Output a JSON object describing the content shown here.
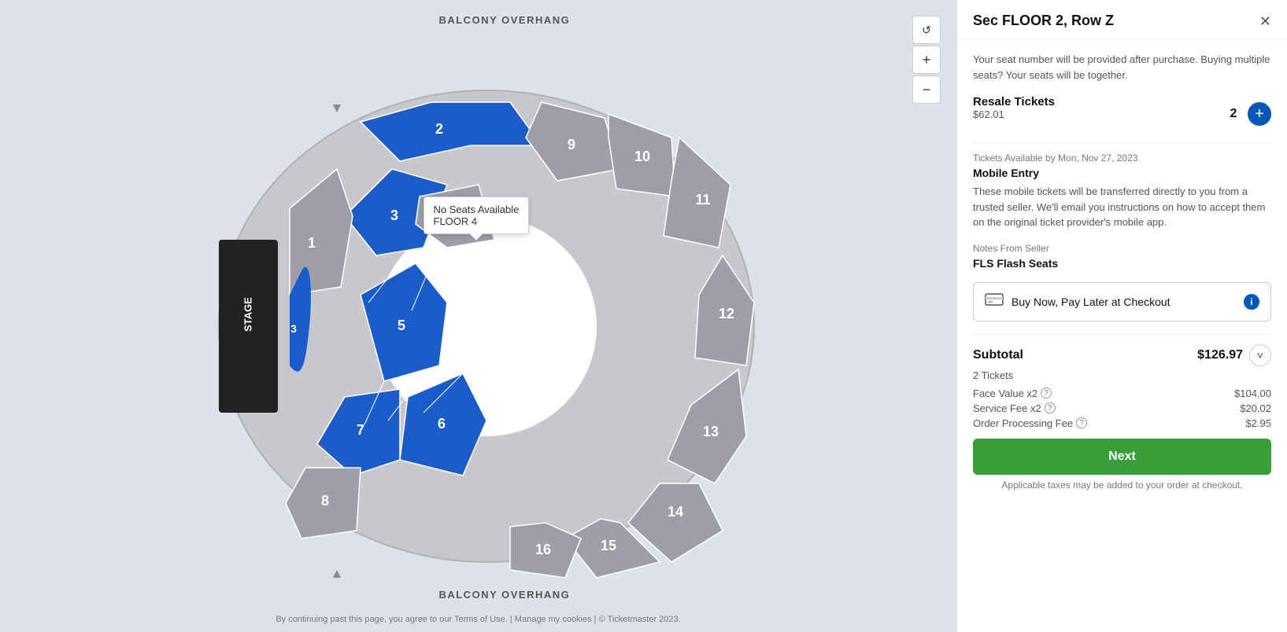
{
  "map": {
    "balcony_top": "BALCONY OVERHANG",
    "balcony_bottom": "BALCONY OVERHANG",
    "stage_label": "STAGE",
    "footer": "By continuing past this page, you agree to our Terms of Use. | Manage my cookies | © Ticketmaster 2023.",
    "tooltip": {
      "line1": "No Seats Available",
      "line2": "FLOOR 4"
    },
    "zoom": {
      "reset_icon": "↺",
      "plus_icon": "+",
      "minus_icon": "−"
    }
  },
  "panel": {
    "title": "Sec FLOOR 2, Row Z",
    "close_icon": "✕",
    "seat_info": "Your seat number will be provided after purchase. Buying multiple seats? Your seats will be together.",
    "resale_label": "Resale Tickets",
    "resale_price": "$62.01",
    "qty": "2",
    "add_icon": "+",
    "availability_label": "Tickets Available by Mon, Nov 27, 2023",
    "mobile_entry_title": "Mobile Entry",
    "mobile_entry_text": "These mobile tickets will be transferred directly to you from a trusted seller. We'll email you instructions on how to accept them on the original ticket provider's mobile app.",
    "notes_label": "Notes From Seller",
    "notes_value": "FLS Flash Seats",
    "buy_now_text": "Buy Now, Pay Later at Checkout",
    "subtotal_label": "Subtotal",
    "subtotal_amount": "$126.97",
    "subtotal_toggle": "˅",
    "tickets_count": "2 Tickets",
    "fees": [
      {
        "label": "Face Value x2",
        "has_question": true,
        "amount": "$104.00"
      },
      {
        "label": "Service Fee x2",
        "has_question": true,
        "amount": "$20.02"
      },
      {
        "label": "Order Processing Fee",
        "has_question": true,
        "amount": "$2.95"
      }
    ],
    "next_label": "Next",
    "taxes_note": "Applicable taxes may be added to your order at checkout."
  }
}
